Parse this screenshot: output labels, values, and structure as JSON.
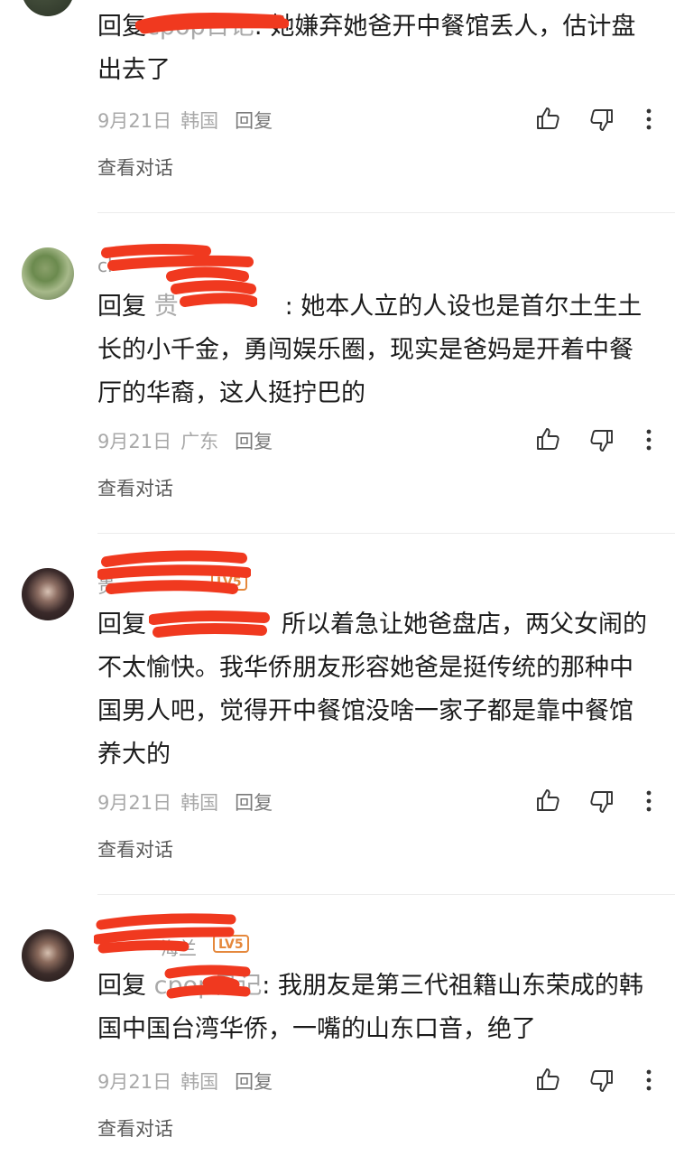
{
  "comments": [
    {
      "username": "",
      "badge": "",
      "reply_prefix": "回复",
      "reply_target": "cpop日记",
      "text": ": 她嫌弃她爸开中餐馆丢人，估计盘出去了",
      "date": "9月21日",
      "location": "韩国",
      "reply_label": "回复",
      "view_conversation": "查看对话"
    },
    {
      "username": "cl",
      "badge": "",
      "reply_prefix": "回复",
      "reply_target": "贵",
      "text": ": 她本人立的人设也是首尔土生土长的小千金，勇闯娱乐圈，现实是爸妈是开着中餐厅的华裔，这人挺拧巴的",
      "date": "9月21日",
      "location": "广东",
      "reply_label": "回复",
      "view_conversation": "查看对话"
    },
    {
      "username": "贵",
      "badge": "LV5",
      "reply_prefix": "回复",
      "reply_target": "",
      "text": "所以着急让她爸盘店，两父女闹的不太愉快。我华侨朋友形容她爸是挺传统的那种中国男人吧，觉得开中餐馆没啥一家子都是靠中餐馆养大的",
      "date": "9月21日",
      "location": "韩国",
      "reply_label": "回复",
      "view_conversation": "查看对话"
    },
    {
      "username": "海兰",
      "badge": "LV5",
      "reply_prefix": "回复",
      "reply_target": "cpop日记",
      "text": ": 我朋友是第三代祖籍山东荣成的韩国中国台湾华侨，一嘴的山东口音，绝了",
      "date": "9月21日",
      "location": "韩国",
      "reply_label": "回复",
      "view_conversation": "查看对话"
    }
  ],
  "icons": {
    "like": "thumbs-up-icon",
    "dislike": "thumbs-down-icon",
    "more": "more-vertical-icon"
  },
  "colors": {
    "redaction": "#f0391f",
    "badge": "#e5883c",
    "meta": "#a8a8a8"
  }
}
